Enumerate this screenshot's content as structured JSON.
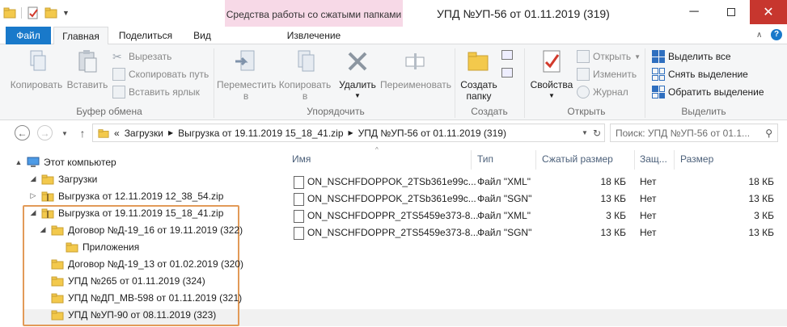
{
  "window": {
    "title": "УПД №УП-56 от 01.11.2019 (319)",
    "context_tab_title": "Средства работы со сжатыми папками",
    "context_tab_label": "Извлечение"
  },
  "tabs": [
    "Файл",
    "Главная",
    "Поделиться",
    "Вид"
  ],
  "ribbon": {
    "clipboard": {
      "copy": "Копировать",
      "paste": "Вставить",
      "cut": "Вырезать",
      "copy_path": "Скопировать путь",
      "paste_shortcut": "Вставить ярлык",
      "label": "Буфер обмена"
    },
    "organize": {
      "move_l1": "Переместить",
      "move_l2": "в",
      "copy_l1": "Копировать",
      "copy_l2": "в",
      "delete": "Удалить",
      "rename": "Переименовать",
      "label": "Упорядочить"
    },
    "new": {
      "new_folder_l1": "Создать",
      "new_folder_l2": "папку",
      "label": "Создать"
    },
    "open": {
      "properties": "Свойства",
      "open": "Открыть",
      "edit": "Изменить",
      "history": "Журнал",
      "label": "Открыть"
    },
    "select": {
      "select_all": "Выделить все",
      "select_none": "Снять выделение",
      "invert": "Обратить выделение",
      "label": "Выделить"
    }
  },
  "address": {
    "prefix": "«",
    "crumbs": [
      "Загрузки",
      "Выгрузка от 19.11.2019 15_18_41.zip",
      "УПД №УП-56 от 01.11.2019 (319)"
    ],
    "search_placeholder": "Поиск: УПД №УП-56 от 01.1..."
  },
  "tree": [
    {
      "label": "Этот компьютер",
      "indent": 0,
      "arrow": "▲"
    },
    {
      "label": "Загрузки",
      "indent": 1,
      "arrow": "◢"
    },
    {
      "label": "Выгрузка от 12.11.2019 12_38_54.zip",
      "indent": 2,
      "arrow": "▷"
    },
    {
      "label": "Выгрузка от 19.11.2019 15_18_41.zip",
      "indent": 2,
      "arrow": "◢"
    },
    {
      "label": "Договор №Д-19_16 от 19.11.2019 (322)",
      "indent": 3,
      "arrow": "◢"
    },
    {
      "label": "Приложения",
      "indent": 4,
      "arrow": ""
    },
    {
      "label": "Договор №Д-19_13 от 01.02.2019 (320)",
      "indent": 3,
      "arrow": ""
    },
    {
      "label": "УПД №265 от 01.11.2019 (324)",
      "indent": 3,
      "arrow": ""
    },
    {
      "label": "УПД №ДП_МВ-598 от 01.11.2019 (321)",
      "indent": 3,
      "arrow": ""
    },
    {
      "label": "УПД №УП-90 от 08.11.2019 (323)",
      "indent": 3,
      "arrow": ""
    }
  ],
  "columns": [
    "Имя",
    "Тип",
    "Сжатый размер",
    "Защ...",
    "Размер"
  ],
  "files": [
    {
      "name": "ON_NSCHFDOPPOK_2TSb361e99c...",
      "type": "Файл \"XML\"",
      "csize": "18 КБ",
      "prot": "Нет",
      "size": "18 КБ"
    },
    {
      "name": "ON_NSCHFDOPPOK_2TSb361e99c...",
      "type": "Файл \"SGN\"",
      "csize": "13 КБ",
      "prot": "Нет",
      "size": "13 КБ"
    },
    {
      "name": "ON_NSCHFDOPPR_2TS5459e373-8...",
      "type": "Файл \"XML\"",
      "csize": "3 КБ",
      "prot": "Нет",
      "size": "3 КБ"
    },
    {
      "name": "ON_NSCHFDOPPR_2TS5459e373-8...",
      "type": "Файл \"SGN\"",
      "csize": "13 КБ",
      "prot": "Нет",
      "size": "13 КБ"
    }
  ],
  "colors": {
    "accent": "#1979ca",
    "context_tab": "#f7d9e7",
    "highlight_box": "#e29a58",
    "folder": "#f3c94c"
  }
}
